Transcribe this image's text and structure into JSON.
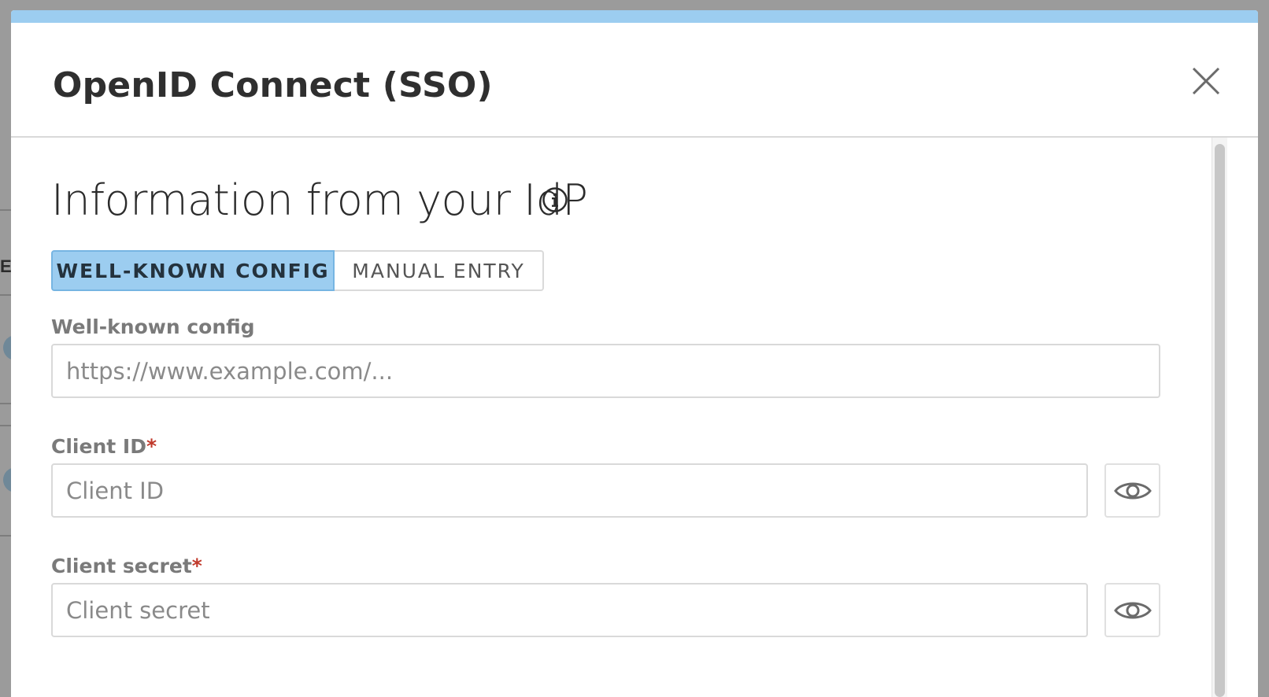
{
  "background": {
    "partial_letter": "E"
  },
  "modal": {
    "title": "OpenID Connect (SSO)",
    "close_icon": "close-icon",
    "accent_color": "#9ccdf0"
  },
  "section": {
    "title": "Information from your IdP",
    "info_icon": "info-icon"
  },
  "tabs": [
    {
      "label": "WELL-KNOWN CONFIG",
      "active": true
    },
    {
      "label": "MANUAL ENTRY",
      "active": false
    }
  ],
  "fields": {
    "well_known": {
      "label": "Well-known config",
      "placeholder": "https://www.example.com/...",
      "value": ""
    },
    "client_id": {
      "label": "Client ID",
      "required_mark": "*",
      "placeholder": "Client ID",
      "value": "",
      "toggle_icon": "eye-icon"
    },
    "client_secret": {
      "label": "Client secret",
      "required_mark": "*",
      "placeholder": "Client secret",
      "value": "",
      "toggle_icon": "eye-icon"
    }
  }
}
